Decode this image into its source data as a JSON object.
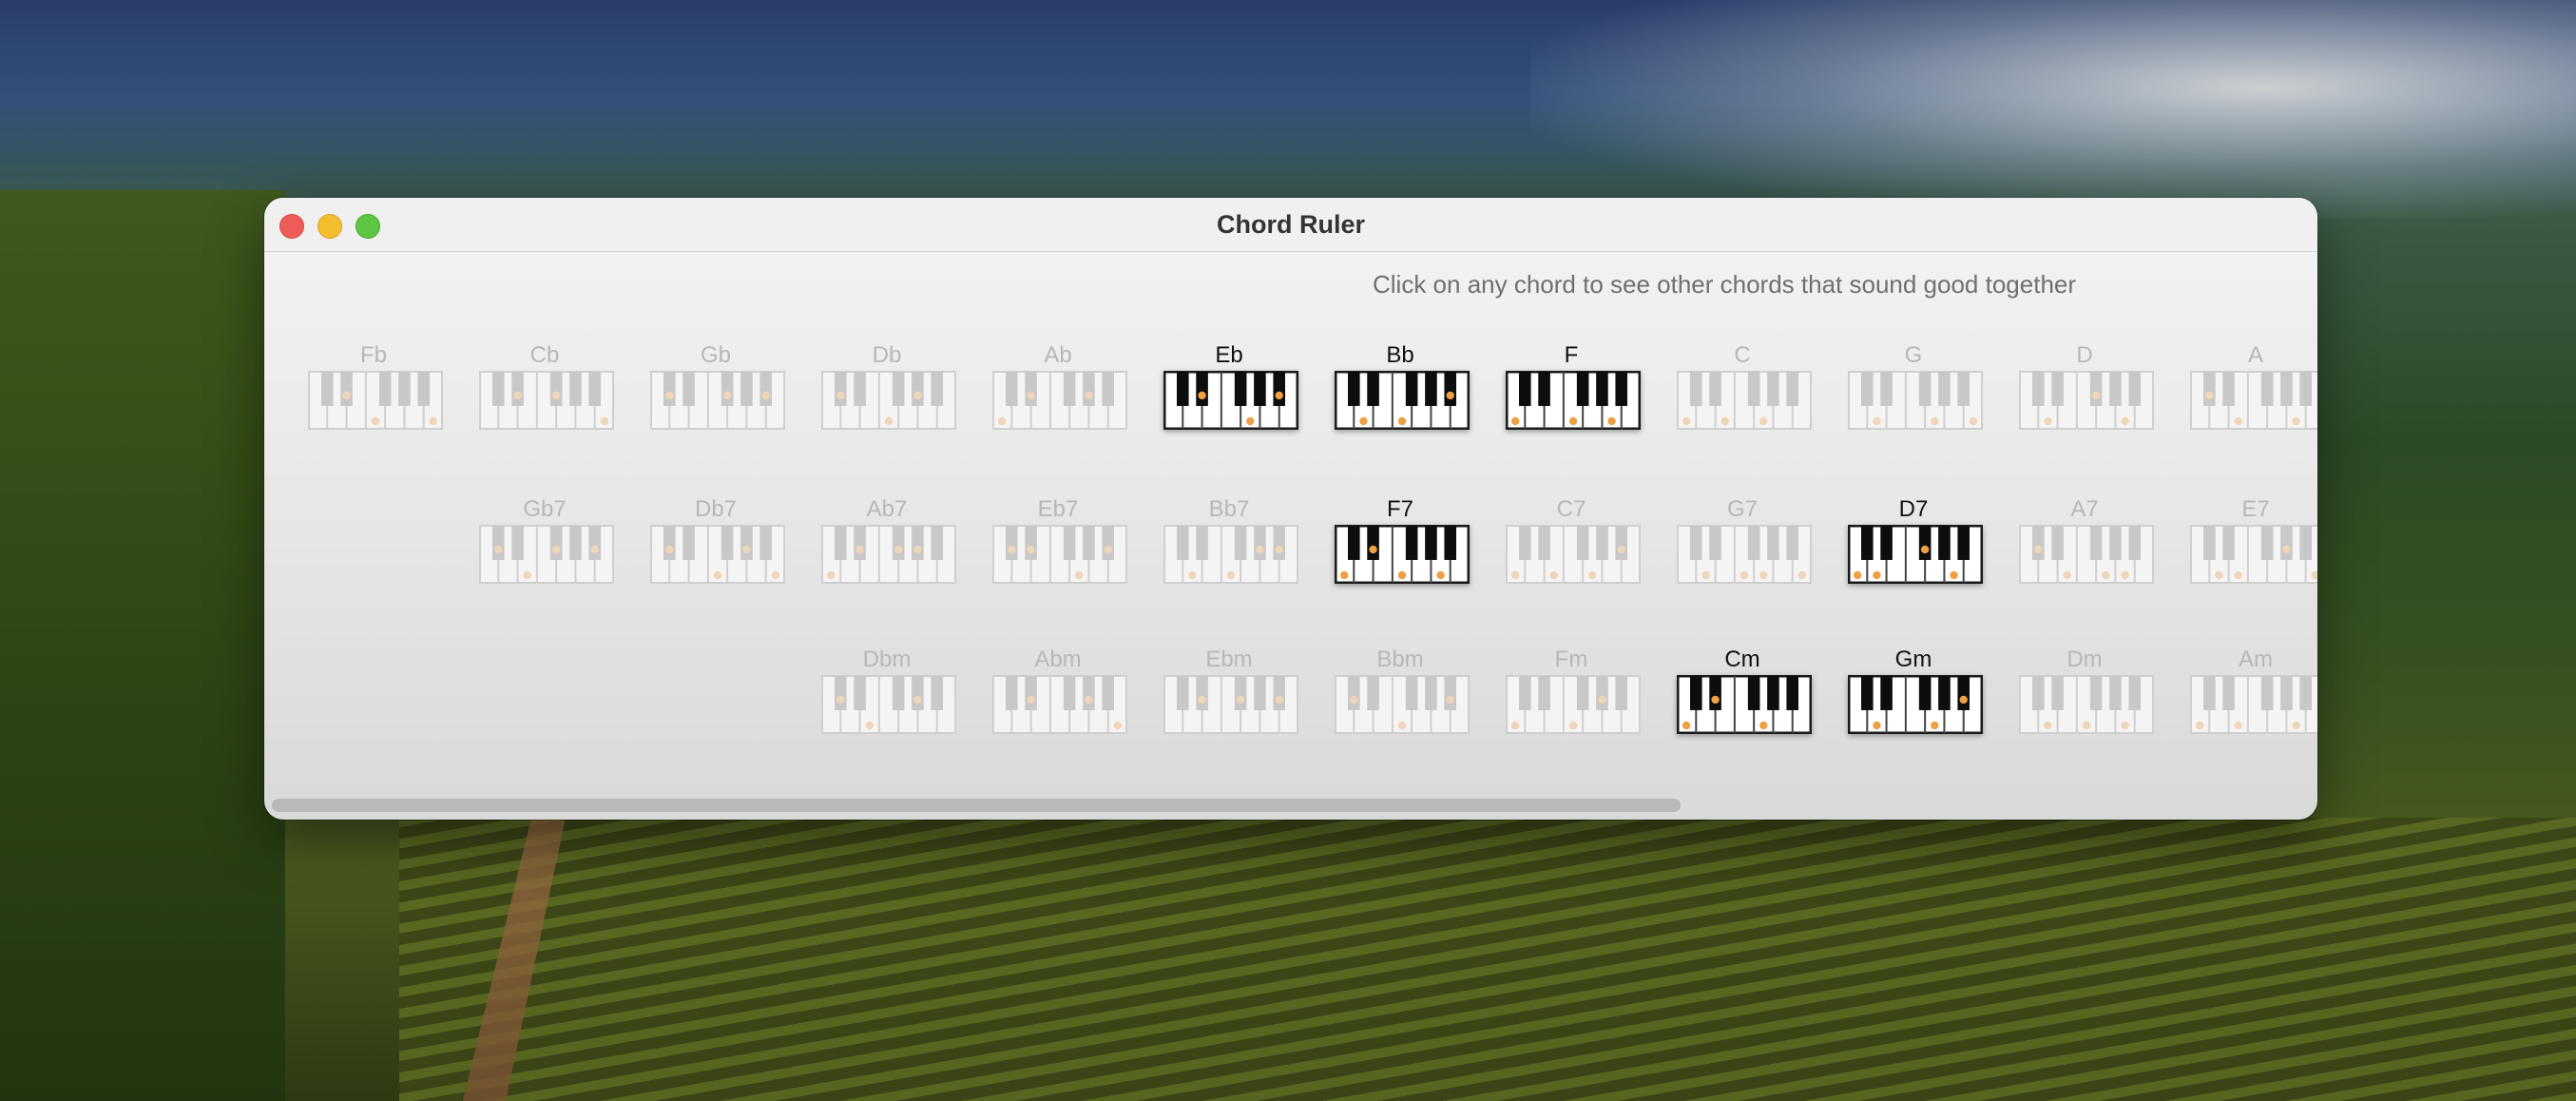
{
  "window": {
    "title": "Chord Ruler"
  },
  "hint": "Click on any chord to see other chords that sound good together",
  "rows": [
    {
      "chords": [
        {
          "name": "Fb",
          "active": false,
          "dots": [
            3,
            5,
            11
          ]
        },
        {
          "name": "Cb",
          "active": false,
          "dots": [
            3,
            6,
            11
          ]
        },
        {
          "name": "Gb",
          "active": false,
          "dots": [
            1,
            6,
            10
          ]
        },
        {
          "name": "Db",
          "active": false,
          "dots": [
            1,
            5,
            8
          ]
        },
        {
          "name": "Ab",
          "active": false,
          "dots": [
            0,
            3,
            8
          ]
        },
        {
          "name": "Eb",
          "active": true,
          "dots": [
            3,
            7,
            10
          ]
        },
        {
          "name": "Bb",
          "active": true,
          "dots": [
            2,
            5,
            10
          ]
        },
        {
          "name": "F",
          "active": true,
          "dots": [
            0,
            5,
            9
          ]
        },
        {
          "name": "C",
          "active": false,
          "dots": [
            0,
            4,
            7
          ]
        },
        {
          "name": "G",
          "active": false,
          "dots": [
            2,
            7,
            11
          ]
        },
        {
          "name": "D",
          "active": false,
          "dots": [
            2,
            6,
            9
          ]
        },
        {
          "name": "A",
          "active": false,
          "dots": [
            1,
            4,
            9
          ]
        }
      ]
    },
    {
      "chords": [
        {
          "name": "Gb7",
          "active": false,
          "dots": [
            1,
            4,
            6,
            10
          ]
        },
        {
          "name": "Db7",
          "active": false,
          "dots": [
            1,
            5,
            8,
            11
          ]
        },
        {
          "name": "Ab7",
          "active": false,
          "dots": [
            0,
            3,
            6,
            8
          ]
        },
        {
          "name": "Eb7",
          "active": false,
          "dots": [
            1,
            3,
            7,
            10
          ]
        },
        {
          "name": "Bb7",
          "active": false,
          "dots": [
            2,
            5,
            8,
            10
          ]
        },
        {
          "name": "F7",
          "active": true,
          "dots": [
            0,
            3,
            5,
            9
          ]
        },
        {
          "name": "C7",
          "active": false,
          "dots": [
            0,
            4,
            7,
            10
          ]
        },
        {
          "name": "G7",
          "active": false,
          "dots": [
            2,
            5,
            7,
            11
          ]
        },
        {
          "name": "D7",
          "active": true,
          "dots": [
            0,
            2,
            6,
            9
          ]
        },
        {
          "name": "A7",
          "active": false,
          "dots": [
            1,
            4,
            7,
            9
          ]
        },
        {
          "name": "E7",
          "active": false,
          "dots": [
            2,
            4,
            8,
            11
          ]
        }
      ]
    },
    {
      "chords": [
        {
          "name": "Dbm",
          "active": false,
          "dots": [
            1,
            4,
            8
          ]
        },
        {
          "name": "Abm",
          "active": false,
          "dots": [
            3,
            8,
            11
          ]
        },
        {
          "name": "Ebm",
          "active": false,
          "dots": [
            3,
            6,
            10
          ]
        },
        {
          "name": "Bbm",
          "active": false,
          "dots": [
            1,
            5,
            10
          ]
        },
        {
          "name": "Fm",
          "active": false,
          "dots": [
            0,
            5,
            8
          ]
        },
        {
          "name": "Cm",
          "active": true,
          "dots": [
            0,
            3,
            7
          ]
        },
        {
          "name": "Gm",
          "active": true,
          "dots": [
            2,
            7,
            10
          ]
        },
        {
          "name": "Dm",
          "active": false,
          "dots": [
            2,
            5,
            9
          ]
        },
        {
          "name": "Am",
          "active": false,
          "dots": [
            0,
            4,
            9
          ]
        }
      ]
    }
  ]
}
